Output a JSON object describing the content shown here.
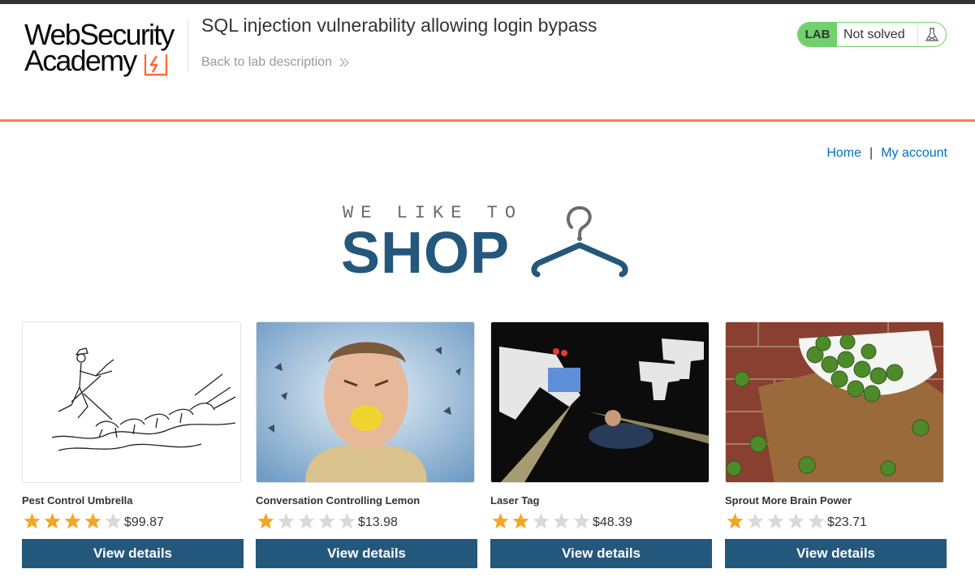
{
  "header": {
    "logo_line1": "WebSecurity",
    "logo_line2": "Academy",
    "lab_title": "SQL injection vulnerability allowing login bypass",
    "back_link": "Back to lab description",
    "lab_badge": {
      "label": "LAB",
      "status": "Not solved"
    }
  },
  "nav": {
    "home": "Home",
    "separator": "|",
    "account": "My account"
  },
  "banner": {
    "tagline": "WE LIKE TO",
    "headline": "SHOP"
  },
  "products": [
    {
      "name": "Pest Control Umbrella",
      "rating": 4,
      "price": "$99.87",
      "button": "View details",
      "image": "umbrella-sketch-image"
    },
    {
      "name": "Conversation Controlling Lemon",
      "rating": 1,
      "price": "$13.98",
      "button": "View details",
      "image": "man-with-lemon-image"
    },
    {
      "name": "Laser Tag",
      "rating": 2,
      "price": "$48.39",
      "button": "View details",
      "image": "laser-tag-image"
    },
    {
      "name": "Sprout More Brain Power",
      "rating": 1,
      "price": "$23.71",
      "button": "View details",
      "image": "brussels-sprouts-image"
    }
  ],
  "colors": {
    "brand_blue": "#24577c",
    "accent_orange": "#ff6633",
    "lab_green": "#70d16d",
    "star_gold": "#f5a623",
    "star_empty": "#d9d9d9",
    "link_blue": "#0071bc"
  }
}
